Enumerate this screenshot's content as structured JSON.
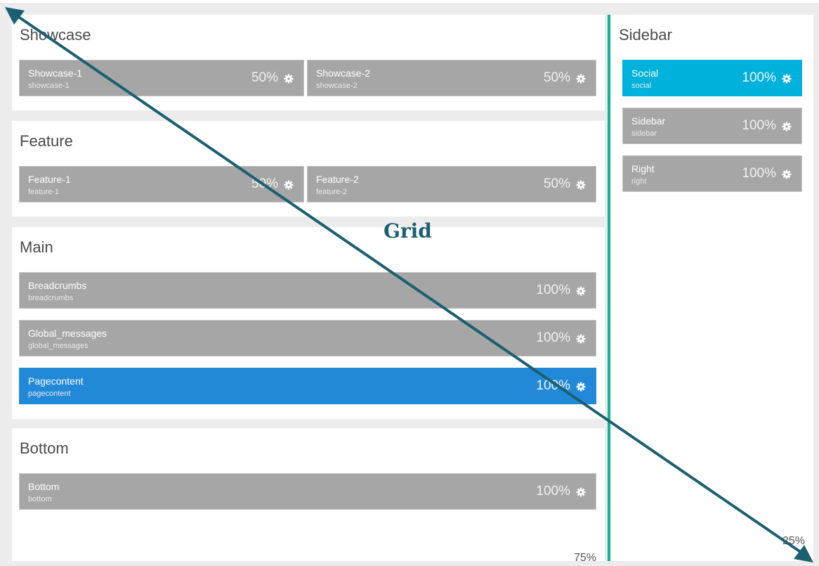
{
  "colors": {
    "block_default": "#a6a6a6",
    "block_blue": "#2289d8",
    "block_cyan": "#00b1dc",
    "divider": "#11b595",
    "arrow": "#1b5f70"
  },
  "annotation": {
    "label": "Grid"
  },
  "left_column": {
    "width_label": "75%",
    "sections": [
      {
        "title": "Showcase",
        "blocks": [
          {
            "title": "Showcase-1",
            "sub": "showcase-1",
            "pct": "50%"
          },
          {
            "title": "Showcase-2",
            "sub": "showcase-2",
            "pct": "50%"
          }
        ]
      },
      {
        "title": "Feature",
        "blocks": [
          {
            "title": "Feature-1",
            "sub": "feature-1",
            "pct": "50%"
          },
          {
            "title": "Feature-2",
            "sub": "feature-2",
            "pct": "50%"
          }
        ]
      },
      {
        "title": "Main",
        "blocks": [
          {
            "title": "Breadcrumbs",
            "sub": "breadcrumbs",
            "pct": "100%"
          },
          {
            "title": "Global_messages",
            "sub": "global_messages",
            "pct": "100%"
          },
          {
            "title": "Pagecontent",
            "sub": "pagecontent",
            "pct": "100%",
            "active": true
          }
        ]
      },
      {
        "title": "Bottom",
        "blocks": [
          {
            "title": "Bottom",
            "sub": "bottom",
            "pct": "100%"
          }
        ]
      }
    ]
  },
  "sidebar": {
    "title": "Sidebar",
    "width_label": "25%",
    "blocks": [
      {
        "title": "Social",
        "sub": "social",
        "pct": "100%",
        "active": true
      },
      {
        "title": "Sidebar",
        "sub": "sidebar",
        "pct": "100%"
      },
      {
        "title": "Right",
        "sub": "right",
        "pct": "100%"
      }
    ]
  }
}
